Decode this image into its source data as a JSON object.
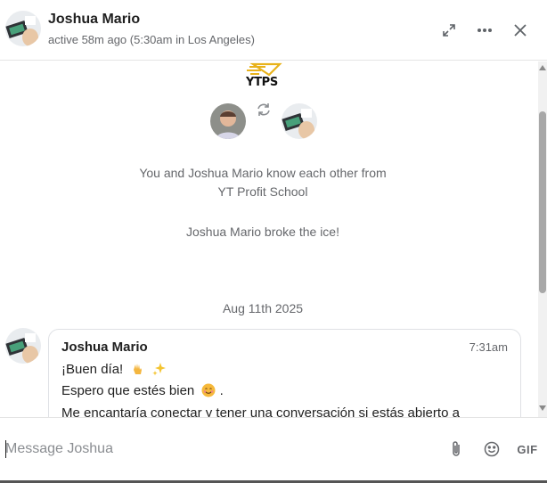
{
  "header": {
    "name": "Joshua Mario",
    "status": "active 58m ago (5:30am in Los Angeles)",
    "icons": {
      "expand": "expand-icon",
      "more": "more-horizontal-icon",
      "close": "close-icon"
    }
  },
  "intro": {
    "logo_text": "YTPS",
    "line1": "You and Joshua Mario know each other from",
    "line2": "YT Profit School",
    "ice": "Joshua Mario broke the ice!"
  },
  "date_separator": "Aug 11th 2025",
  "message": {
    "sender": "Joshua Mario",
    "time": "7:31am",
    "lines": [
      "¡Buen día!",
      "Espero que estés bien",
      "Me encantaría conectar y tener una conversación si estás abierto a"
    ],
    "line2_suffix": "."
  },
  "composer": {
    "placeholder": "Message Joshua",
    "gif_label": "GIF"
  },
  "colors": {
    "secondary_text": "#65676b",
    "border": "#dfe1e5",
    "logo_gold": "#e8b21a"
  }
}
